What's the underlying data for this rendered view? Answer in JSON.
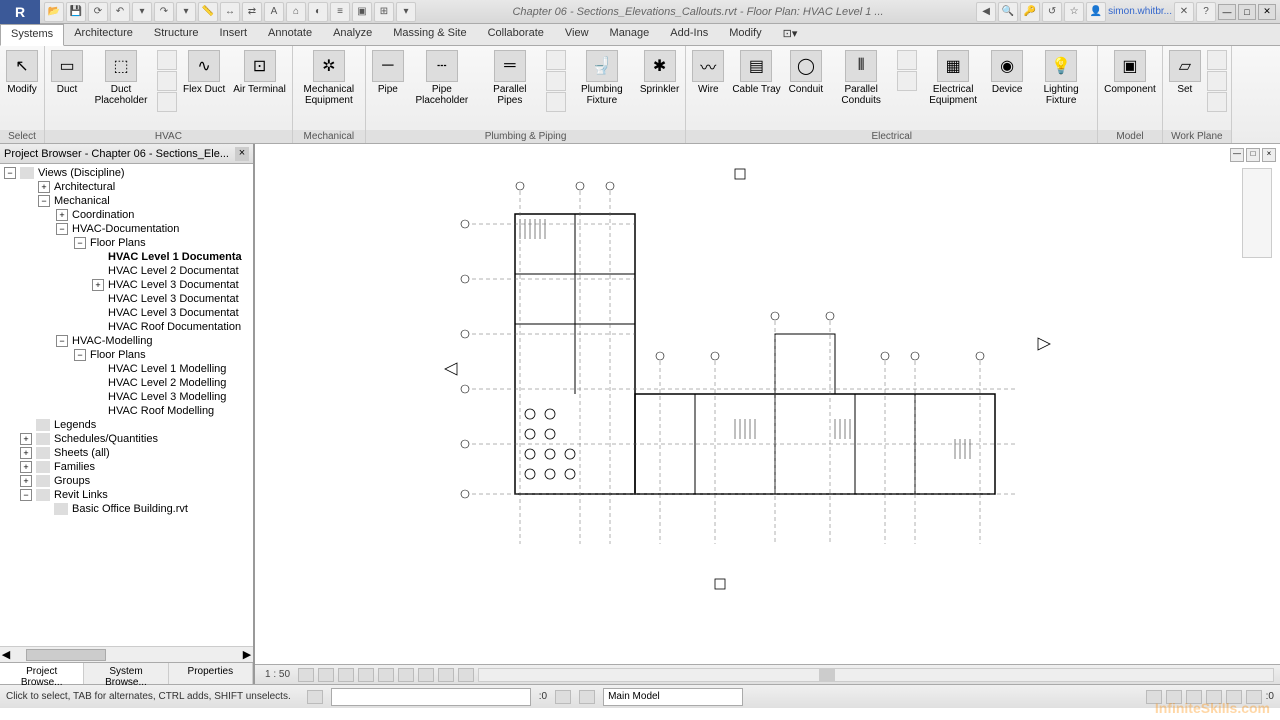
{
  "title": "Chapter 06 - Sections_Elevations_Callouts.rvt - Floor Plan: HVAC Level 1 ...",
  "user": "simon.whitbr...",
  "ribbon_tabs": [
    "Systems",
    "Architecture",
    "Structure",
    "Insert",
    "Annotate",
    "Analyze",
    "Massing & Site",
    "Collaborate",
    "View",
    "Manage",
    "Add-Ins",
    "Modify"
  ],
  "active_tab": 0,
  "ribbon": {
    "modify": {
      "label": "Modify",
      "title": "Select"
    },
    "hvac": {
      "title": "HVAC",
      "buttons": [
        {
          "label": "Duct"
        },
        {
          "label": "Duct Placeholder"
        },
        {
          "label": "Flex Duct"
        },
        {
          "label": "Air Terminal"
        }
      ]
    },
    "mechanical": {
      "title": "Mechanical",
      "buttons": [
        {
          "label": "Mechanical Equipment"
        }
      ]
    },
    "plumbing": {
      "title": "Plumbing & Piping",
      "buttons": [
        {
          "label": "Pipe"
        },
        {
          "label": "Pipe Placeholder"
        },
        {
          "label": "Parallel Pipes"
        },
        {
          "label": "Plumbing Fixture"
        },
        {
          "label": "Sprinkler"
        }
      ]
    },
    "electrical": {
      "title": "Electrical",
      "buttons": [
        {
          "label": "Wire"
        },
        {
          "label": "Cable Tray"
        },
        {
          "label": "Conduit"
        },
        {
          "label": "Parallel Conduits"
        },
        {
          "label": "Electrical Equipment"
        },
        {
          "label": "Device"
        },
        {
          "label": "Lighting Fixture"
        }
      ]
    },
    "model": {
      "title": "Model",
      "buttons": [
        {
          "label": "Component"
        }
      ]
    },
    "workplane": {
      "title": "Work Plane",
      "buttons": [
        {
          "label": "Set"
        }
      ]
    }
  },
  "browser": {
    "title": "Project Browser - Chapter 06 - Sections_Ele...",
    "root": "Views (Discipline)",
    "nodes": [
      {
        "indent": 1,
        "toggle": "+",
        "label": "Architectural"
      },
      {
        "indent": 1,
        "toggle": "-",
        "label": "Mechanical"
      },
      {
        "indent": 2,
        "toggle": "+",
        "label": "Coordination"
      },
      {
        "indent": 2,
        "toggle": "-",
        "label": "HVAC-Documentation"
      },
      {
        "indent": 3,
        "toggle": "-",
        "label": "Floor Plans"
      },
      {
        "indent": 4,
        "toggle": "",
        "label": "HVAC Level 1 Documenta",
        "bold": true
      },
      {
        "indent": 4,
        "toggle": "",
        "label": "HVAC Level 2 Documentat"
      },
      {
        "indent": 4,
        "toggle": "+",
        "label": "HVAC Level 3 Documentat"
      },
      {
        "indent": 4,
        "toggle": "",
        "label": "HVAC Level 3 Documentat"
      },
      {
        "indent": 4,
        "toggle": "",
        "label": "HVAC Level 3 Documentat"
      },
      {
        "indent": 4,
        "toggle": "",
        "label": "HVAC Roof Documentation"
      },
      {
        "indent": 2,
        "toggle": "-",
        "label": "HVAC-Modelling"
      },
      {
        "indent": 3,
        "toggle": "-",
        "label": "Floor Plans"
      },
      {
        "indent": 4,
        "toggle": "",
        "label": "HVAC Level 1 Modelling"
      },
      {
        "indent": 4,
        "toggle": "",
        "label": "HVAC Level 2 Modelling"
      },
      {
        "indent": 4,
        "toggle": "",
        "label": "HVAC Level 3 Modelling"
      },
      {
        "indent": 4,
        "toggle": "",
        "label": "HVAC Roof Modelling"
      },
      {
        "indent": 0,
        "toggle": "",
        "label": "Legends",
        "icon": true
      },
      {
        "indent": 0,
        "toggle": "+",
        "label": "Schedules/Quantities",
        "icon": true
      },
      {
        "indent": 0,
        "toggle": "+",
        "label": "Sheets (all)",
        "icon": true
      },
      {
        "indent": 0,
        "toggle": "+",
        "label": "Families",
        "icon": true
      },
      {
        "indent": 0,
        "toggle": "+",
        "label": "Groups",
        "icon": true
      },
      {
        "indent": 0,
        "toggle": "-",
        "label": "Revit Links",
        "icon": true
      },
      {
        "indent": 1,
        "toggle": "",
        "label": "Basic Office Building.rvt",
        "icon": true
      }
    ],
    "tabs": [
      "Project Browse...",
      "System Browse...",
      "Properties"
    ]
  },
  "viewbar": {
    "scale": "1 : 50"
  },
  "status": {
    "hint": "Click to select, TAB for alternates, CTRL adds, SHIFT unselects.",
    "worksets": ":0",
    "model": "Main Model"
  },
  "watermark": "InfiniteSkills.com"
}
